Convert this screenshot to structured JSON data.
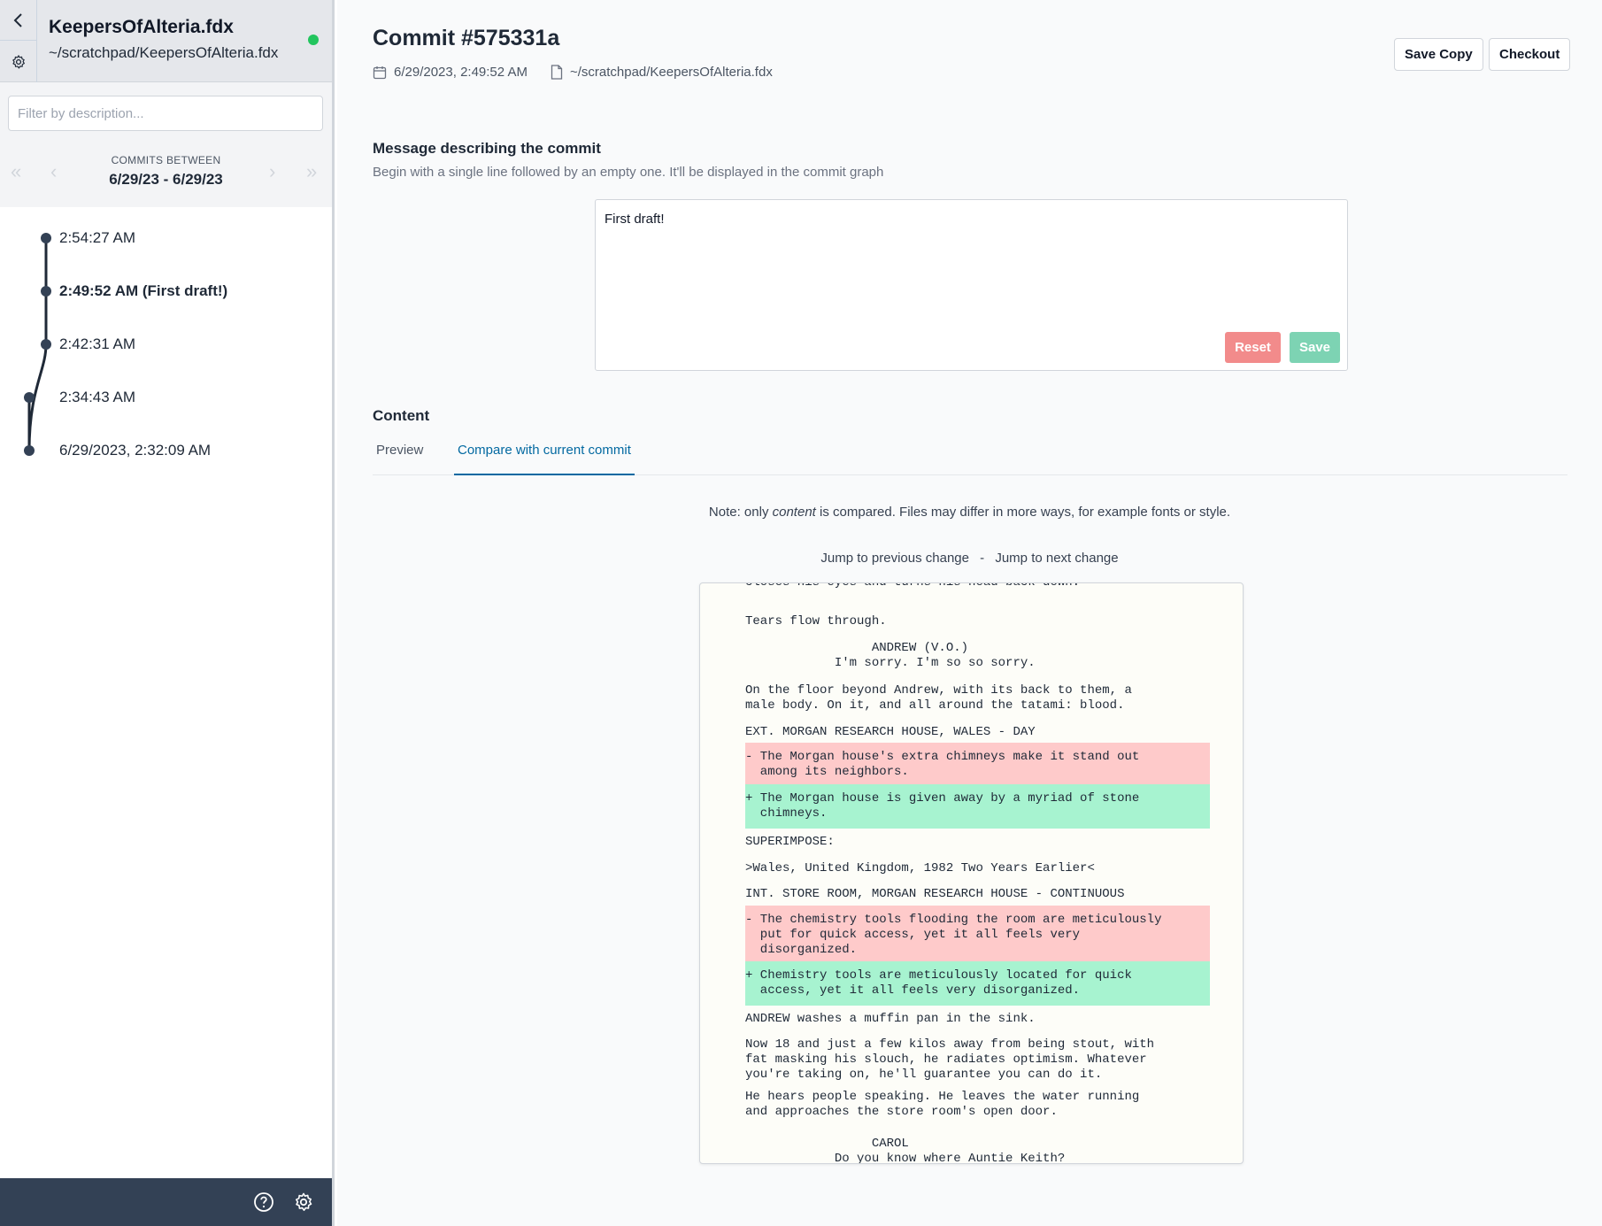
{
  "sidebar": {
    "file_name": "KeepersOfAlteria.fdx",
    "file_path": "~/scratchpad/KeepersOfAlteria.fdx",
    "filter_placeholder": "Filter by description...",
    "commits_between_label": "COMMITS BETWEEN",
    "commits_range": "6/29/23 - 6/29/23",
    "commits": [
      {
        "label": "2:54:27 AM",
        "bold": false
      },
      {
        "label": "2:49:52 AM (First draft!)",
        "bold": true
      },
      {
        "label": "2:42:31 AM",
        "bold": false
      },
      {
        "label": "2:34:43 AM",
        "bold": false
      },
      {
        "label": "6/29/2023, 2:32:09 AM",
        "bold": false
      }
    ]
  },
  "header": {
    "title": "Commit #575331a",
    "date": "6/29/2023, 2:49:52 AM",
    "path": "~/scratchpad/KeepersOfAlteria.fdx",
    "save_copy_label": "Save Copy",
    "checkout_label": "Checkout"
  },
  "message": {
    "title": "Message describing the commit",
    "description": "Begin with a single line followed by an empty one. It'll be displayed in the commit graph",
    "value": "First draft!",
    "reset_label": "Reset",
    "save_label": "Save"
  },
  "content": {
    "title": "Content",
    "tabs": [
      {
        "label": "Preview",
        "active": false
      },
      {
        "label": "Compare with current commit",
        "active": true
      }
    ],
    "note_prefix": "Note: only ",
    "note_em": "content",
    "note_suffix": " is compared. Files may differ in more ways, for example fonts or style.",
    "jump_prev": "Jump to previous change",
    "jump_sep": "-",
    "jump_next": "Jump to next change"
  },
  "diff": {
    "lines": [
      {
        "text": "closes his eyes and turns his head back down.",
        "type": "normal"
      },
      {
        "text": "Tears flow through.",
        "type": "normal"
      },
      {
        "text": "                 ANDREW (V.O.)",
        "type": "normal"
      },
      {
        "text": "            I'm sorry. I'm so so sorry.",
        "type": "normal"
      },
      {
        "text": "On the floor beyond Andrew, with its back to them, a",
        "type": "normal"
      },
      {
        "text": "male body. On it, and all around the tatami: blood.",
        "type": "normal"
      },
      {
        "text": "EXT. MORGAN RESEARCH HOUSE, WALES - DAY",
        "type": "normal"
      },
      {
        "text": "- The Morgan house's extra chimneys make it stand out\n  among its neighbors.",
        "type": "removed"
      },
      {
        "text": "+ The Morgan house is given away by a myriad of stone\n  chimneys.",
        "type": "added"
      },
      {
        "text": "SUPERIMPOSE:",
        "type": "normal"
      },
      {
        "text": ">Wales, United Kingdom, 1982 Two Years Earlier<",
        "type": "normal"
      },
      {
        "text": "INT. STORE ROOM, MORGAN RESEARCH HOUSE - CONTINUOUS",
        "type": "normal"
      },
      {
        "text": "- The chemistry tools flooding the room are meticulously\n  put for quick access, yet it all feels very\n  disorganized.",
        "type": "removed"
      },
      {
        "text": "+ Chemistry tools are meticulously located for quick\n  access, yet it all feels very disorganized.",
        "type": "added"
      },
      {
        "text": "ANDREW washes a muffin pan in the sink.",
        "type": "normal"
      },
      {
        "text": "Now 18 and just a few kilos away from being stout, with\nfat masking his slouch, he radiates optimism. Whatever\nyou're taking on, he'll guarantee you can do it.",
        "type": "normal"
      },
      {
        "text": "He hears people speaking. He leaves the water running\nand approaches the store room's open door.",
        "type": "normal"
      },
      {
        "text": "                 CAROL",
        "type": "normal"
      },
      {
        "text": "            Do you know where Auntie Keith?",
        "type": "normal"
      }
    ]
  }
}
